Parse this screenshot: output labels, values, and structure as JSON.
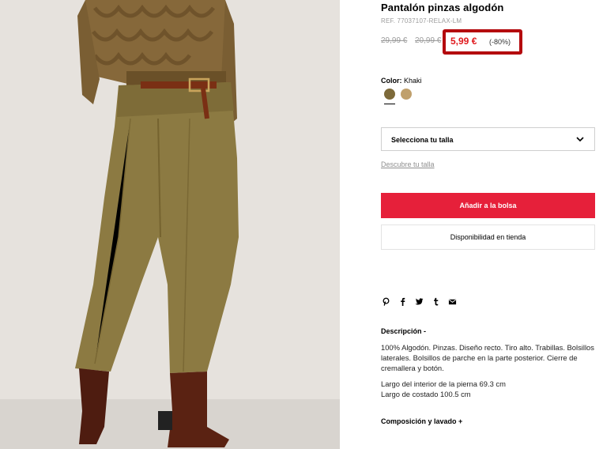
{
  "product": {
    "title": "Pantalón pinzas algodón",
    "ref": "REF. 77037107-RELAX-LM",
    "original_price": "29,99 €",
    "previous_price": "20,99 €",
    "current_price": "5,99 €",
    "discount": "(-80%)"
  },
  "color": {
    "label": "Color:",
    "value": "Khaki",
    "swatches": [
      {
        "name": "Khaki",
        "hex": "#7d6a3a",
        "selected": true
      },
      {
        "name": "Beige",
        "hex": "#c0a06c",
        "selected": false
      }
    ]
  },
  "size": {
    "select_label": "Selecciona tu talla",
    "guide_link": "Descubre tu talla"
  },
  "actions": {
    "add_to_bag": "Añadir a la bolsa",
    "store_availability": "Disponibilidad en tienda"
  },
  "share": {
    "icons": [
      "pinterest-icon",
      "facebook-icon",
      "twitter-icon",
      "tumblr-icon",
      "email-icon"
    ]
  },
  "description": {
    "title": "Descripción  -",
    "body": "100% Algodón. Pinzas. Diseño recto. Tiro alto. Trabillas. Bolsillos laterales. Bolsillos de parche en la parte posterior. Cierre de cremallera y botón.",
    "measure_1": "Largo del interior de la pierna 69.3 cm",
    "measure_2": "Largo de costado 100.5 cm"
  },
  "composition": {
    "title": "Composición y lavado  +"
  },
  "colors": {
    "accent_red": "#e6203a",
    "sale_red": "#e0191d",
    "highlight_border": "#b40a0e"
  }
}
